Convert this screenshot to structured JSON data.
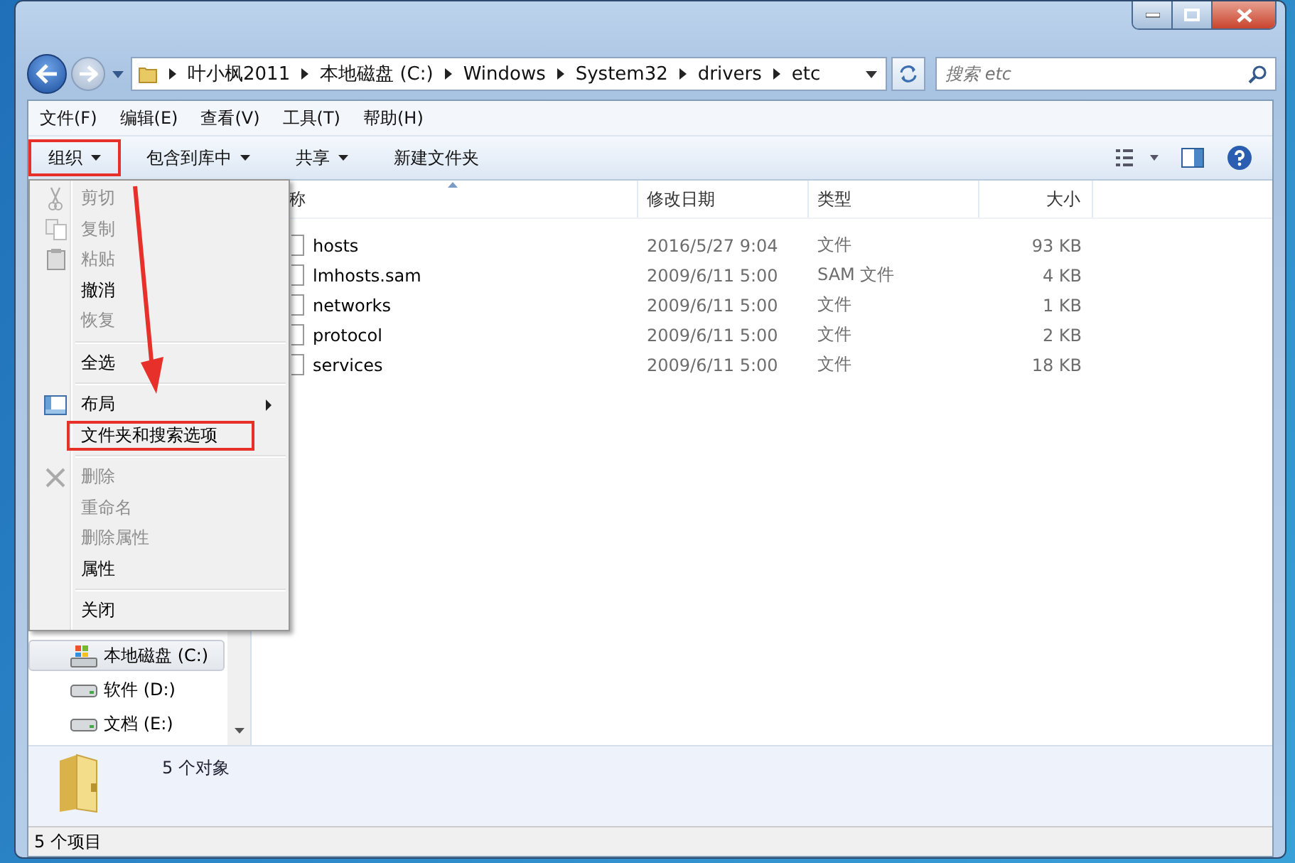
{
  "address_bar": {
    "crumbs": [
      "叶小枫2011",
      "本地磁盘 (C:)",
      "Windows",
      "System32",
      "drivers",
      "etc"
    ]
  },
  "search": {
    "placeholder": "搜索 etc"
  },
  "menu_bar": [
    "文件(F)",
    "编辑(E)",
    "查看(V)",
    "工具(T)",
    "帮助(H)"
  ],
  "toolbar": [
    {
      "label": "组织",
      "dropdown": true,
      "outlined": true
    },
    {
      "label": "包含到库中",
      "dropdown": true,
      "outlined": false
    },
    {
      "label": "共享",
      "dropdown": true,
      "outlined": false
    },
    {
      "label": "新建文件夹",
      "dropdown": false,
      "outlined": false
    }
  ],
  "organize_menu": {
    "sections": [
      [
        {
          "label": "剪切",
          "kind": "scissors",
          "disabled": true,
          "submenu": false,
          "outlined": false
        },
        {
          "label": "复制",
          "kind": "copy",
          "disabled": true,
          "submenu": false,
          "outlined": false
        },
        {
          "label": "粘贴",
          "kind": "paste",
          "disabled": true,
          "submenu": false,
          "outlined": false
        },
        {
          "label": "撤消",
          "kind": "plain",
          "disabled": false,
          "submenu": false,
          "outlined": false
        },
        {
          "label": "恢复",
          "kind": "plain",
          "disabled": true,
          "submenu": false,
          "outlined": false
        }
      ],
      [
        {
          "label": "全选",
          "kind": "plain",
          "disabled": false,
          "submenu": false,
          "outlined": false
        }
      ],
      [
        {
          "label": "布局",
          "kind": "layout",
          "disabled": false,
          "submenu": true,
          "outlined": false
        },
        {
          "label": "文件夹和搜索选项",
          "kind": "plain",
          "disabled": false,
          "submenu": false,
          "outlined": true
        }
      ],
      [
        {
          "label": "删除",
          "kind": "delete",
          "disabled": true,
          "submenu": false,
          "outlined": false
        },
        {
          "label": "重命名",
          "kind": "plain",
          "disabled": true,
          "submenu": false,
          "outlined": false
        },
        {
          "label": "删除属性",
          "kind": "plain",
          "disabled": true,
          "submenu": false,
          "outlined": false
        },
        {
          "label": "属性",
          "kind": "plain",
          "disabled": false,
          "submenu": false,
          "outlined": false
        }
      ],
      [
        {
          "label": "关闭",
          "kind": "plain",
          "disabled": false,
          "submenu": false,
          "outlined": false
        }
      ]
    ]
  },
  "sidebar": {
    "items": [
      {
        "label": "本地磁盘 (C:)",
        "kind": "system",
        "selected": true
      },
      {
        "label": "软件 (D:)",
        "kind": "drive",
        "selected": false
      },
      {
        "label": "文档 (E:)",
        "kind": "drive",
        "selected": false
      }
    ]
  },
  "table": {
    "columns": [
      "称",
      "修改日期",
      "类型",
      "大小"
    ],
    "rows": [
      [
        "hosts",
        "2016/5/27 9:04",
        "文件",
        "93 KB"
      ],
      [
        "lmhosts.sam",
        "2009/6/11 5:00",
        "SAM 文件",
        "4 KB"
      ],
      [
        "networks",
        "2009/6/11 5:00",
        "文件",
        "1 KB"
      ],
      [
        "protocol",
        "2009/6/11 5:00",
        "文件",
        "2 KB"
      ],
      [
        "services",
        "2009/6/11 5:00",
        "文件",
        "18 KB"
      ]
    ]
  },
  "details_pane": {
    "text": "5 个对象"
  },
  "status_bar": "5 个项目"
}
